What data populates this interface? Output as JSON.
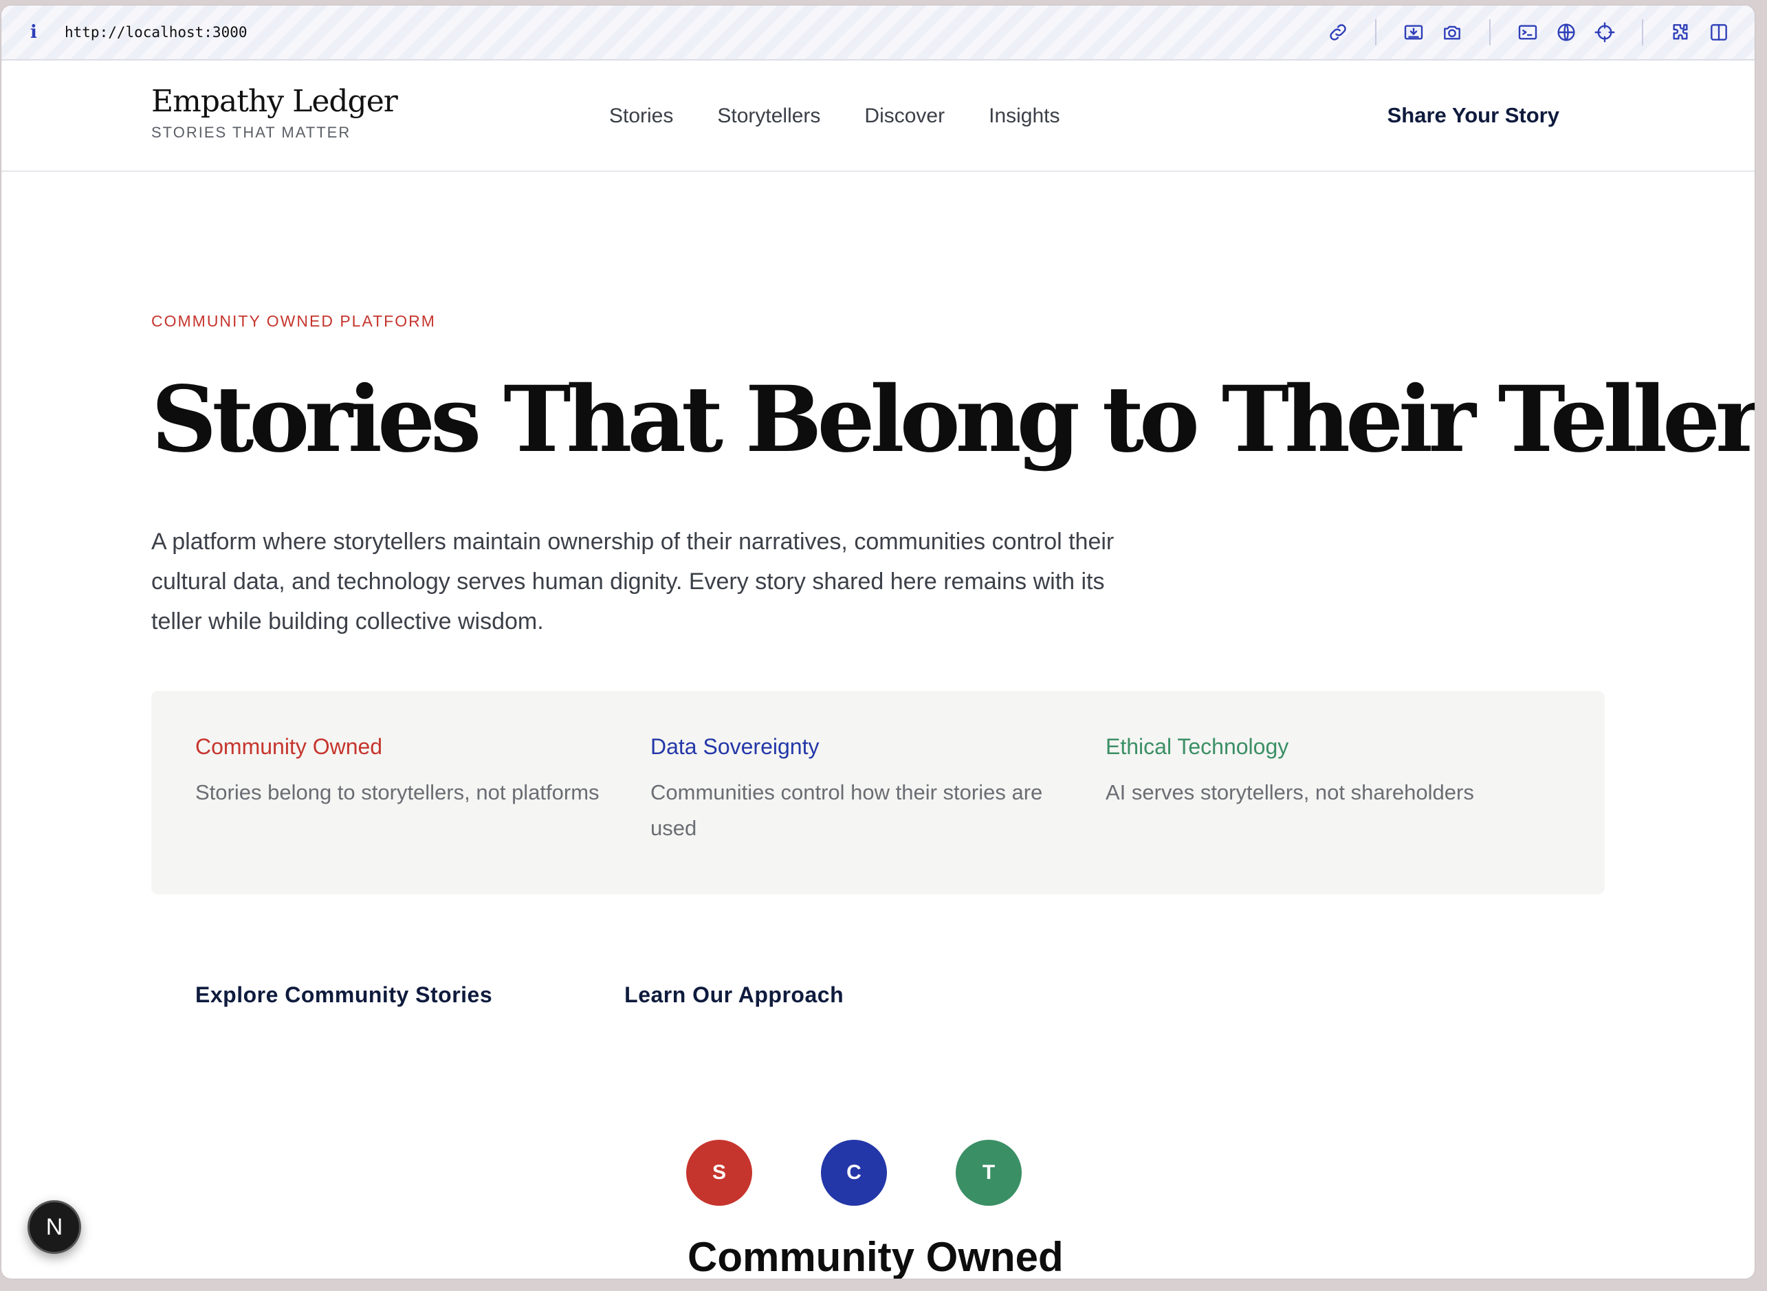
{
  "browser": {
    "url": "http://localhost:3000",
    "toolbar_icons": [
      "link-icon",
      "capture-icon",
      "camera-icon",
      "terminal-icon",
      "globe-icon",
      "crosshair-icon",
      "extension-icon",
      "sidebar-icon"
    ]
  },
  "header": {
    "brand_name": "Empathy Ledger",
    "brand_tagline": "STORIES THAT MATTER",
    "nav": [
      {
        "label": "Stories"
      },
      {
        "label": "Storytellers"
      },
      {
        "label": "Discover"
      },
      {
        "label": "Insights"
      }
    ],
    "cta": "Share Your Story"
  },
  "hero": {
    "eyebrow": "COMMUNITY OWNED PLATFORM",
    "title": "Stories That Belong to Their Tellers",
    "lede": "A platform where storytellers maintain ownership of their narratives, communities control their cultural data, and technology serves human dignity. Every story shared here remains with its teller while building collective wisdom.",
    "pillars": [
      {
        "title": "Community Owned",
        "description": "Stories belong to storytellers, not platforms",
        "color": "#c6352d"
      },
      {
        "title": "Data Sovereignty",
        "description": "Communities control how their stories are used",
        "color": "#2437a8"
      },
      {
        "title": "Ethical Technology",
        "description": "AI serves storytellers, not shareholders",
        "color": "#3b8f65"
      }
    ],
    "actions": {
      "primary": "Explore Community Stories",
      "secondary": "Learn Our Approach"
    }
  },
  "avatars": [
    {
      "letter": "S",
      "color": "#c6352d"
    },
    {
      "letter": "C",
      "color": "#2437a8"
    },
    {
      "letter": "T",
      "color": "#3b8f65"
    }
  ],
  "section_title": "Community Owned",
  "dev_badge": "N"
}
